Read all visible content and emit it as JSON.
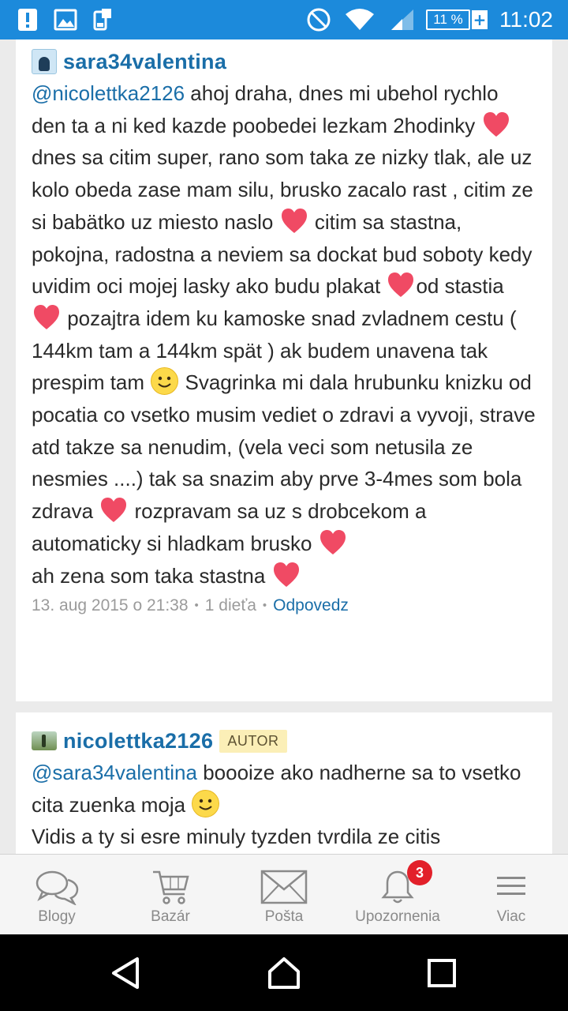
{
  "status_bar": {
    "time": "11:02",
    "battery_percent": "11 %",
    "notification_icons": [
      "alert-icon",
      "gallery-icon",
      "sim-transfer-icon"
    ],
    "system_icons": [
      "do-not-disturb-icon",
      "wifi-icon",
      "signal-icon",
      "battery-icon"
    ]
  },
  "comments": [
    {
      "author": "sara34valentina",
      "is_author": false,
      "mention": "@nicolettka2126",
      "segments": [
        " ahoj draha, dnes mi ubehol rychlo den ta a ni ked kazde poobedei lezkam 2hodinky ",
        " dnes sa citim super, rano som taka ze nizky tlak, ale uz kolo obeda zase mam silu, brusko zacalo rast , citim ze si babätko uz miesto naslo ",
        " citim sa stastna, pokojna, radostna a neviem sa dockat bud soboty kedy uvidim oci mojej lasky ako budu plakat ",
        "od stastia ",
        " pozajtra idem ku kamoske snad zvladnem cestu ( 144km tam a 144km spät ) ak budem unavena tak prespim tam ",
        " Svagrinka mi dala hrubunku knizku od pocatia co vsetko musim vediet o zdravi a vyvoji, strave atd takze sa nenudim, (vela veci som netusila ze nesmies ....) tak sa snazim aby prve 3-4mes som bola zdrava ",
        " rozpravam sa uz s drobcekom a automaticky si hladkam brusko ",
        "ah zena som taka stastna "
      ],
      "date": "13. aug 2015 o 21:38",
      "children": "1 dieťa",
      "reply_label": "Odpovedz"
    },
    {
      "author": "nicolettka2126",
      "is_author": true,
      "author_badge": "AUTOR",
      "mention": "@sara34valentina",
      "segments": [
        " boooize ako nadherne sa to vsetko cita zuenka moja ",
        "Vidis a ty si esre minuly tyzden tvrdila ze citis"
      ]
    }
  ],
  "bottom_nav": {
    "items": [
      {
        "label": "Blogy",
        "icon": "chat-bubbles-icon"
      },
      {
        "label": "Bazár",
        "icon": "shopping-cart-icon"
      },
      {
        "label": "Pošta",
        "icon": "envelope-icon"
      },
      {
        "label": "Upozornenia",
        "icon": "bell-icon",
        "badge": "3"
      },
      {
        "label": "Viac",
        "icon": "menu-icon"
      }
    ]
  },
  "system_nav": [
    "back-icon",
    "home-icon",
    "recent-apps-icon"
  ],
  "colors": {
    "status_bar": "#1c8adb",
    "link": "#1a6ea8",
    "heart": "#f04a64",
    "badge_bg": "#fbefb7",
    "notification_badge": "#e2202a"
  }
}
